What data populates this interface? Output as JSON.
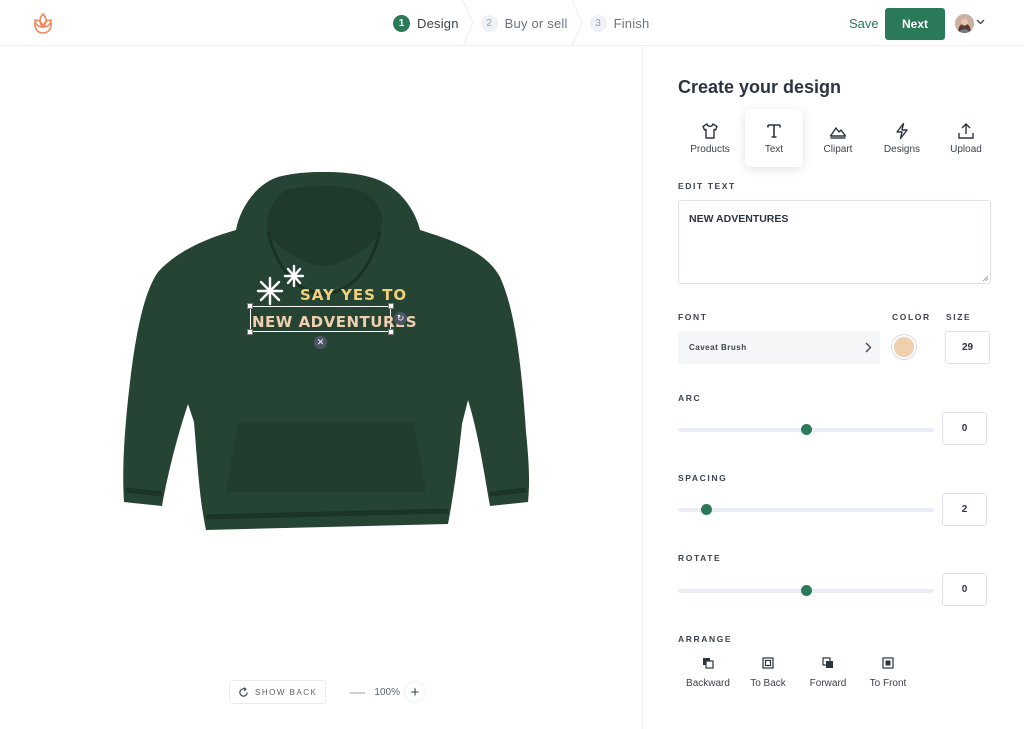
{
  "header": {
    "steps": [
      {
        "num": "1",
        "label": "Design",
        "active": true
      },
      {
        "num": "2",
        "label": "Buy or sell",
        "active": false
      },
      {
        "num": "3",
        "label": "Finish",
        "active": false
      }
    ],
    "save_label": "Save",
    "next_label": "Next"
  },
  "canvas": {
    "design_line1": "SAY YES TO",
    "design_line2": "NEW ADVENTURES",
    "hoodie_color": "#264433",
    "show_back_label": "SHOW BACK",
    "zoom_minus": "—",
    "zoom_value": "100%",
    "zoom_plus": "+"
  },
  "panel": {
    "title": "Create your design",
    "tools": [
      {
        "label": "Products",
        "icon": "tshirt-icon"
      },
      {
        "label": "Text",
        "icon": "text-icon",
        "active": true
      },
      {
        "label": "Clipart",
        "icon": "mountain-icon"
      },
      {
        "label": "Designs",
        "icon": "lightning-icon"
      },
      {
        "label": "Upload",
        "icon": "upload-icon"
      }
    ],
    "edit_text_label": "EDIT TEXT",
    "edit_text_value": "NEW ADVENTURES",
    "font_label": "FONT",
    "font_value": "Caveat Brush",
    "color_label": "COLOR",
    "color_value": "#f0cfae",
    "size_label": "SIZE",
    "size_value": "29",
    "arc_label": "ARC",
    "arc_value": "0",
    "arc_fraction": 0.5,
    "spacing_label": "SPACING",
    "spacing_value": "2",
    "spacing_fraction": 0.11,
    "rotate_label": "ROTATE",
    "rotate_value": "0",
    "rotate_fraction": 0.5,
    "arrange_label": "ARRANGE",
    "arrange": [
      {
        "label": "Backward",
        "icon": "backward-icon"
      },
      {
        "label": "To Back",
        "icon": "to-back-icon"
      },
      {
        "label": "Forward",
        "icon": "forward-icon"
      },
      {
        "label": "To Front",
        "icon": "to-front-icon"
      }
    ],
    "accent_color": "#2a7a5a"
  }
}
